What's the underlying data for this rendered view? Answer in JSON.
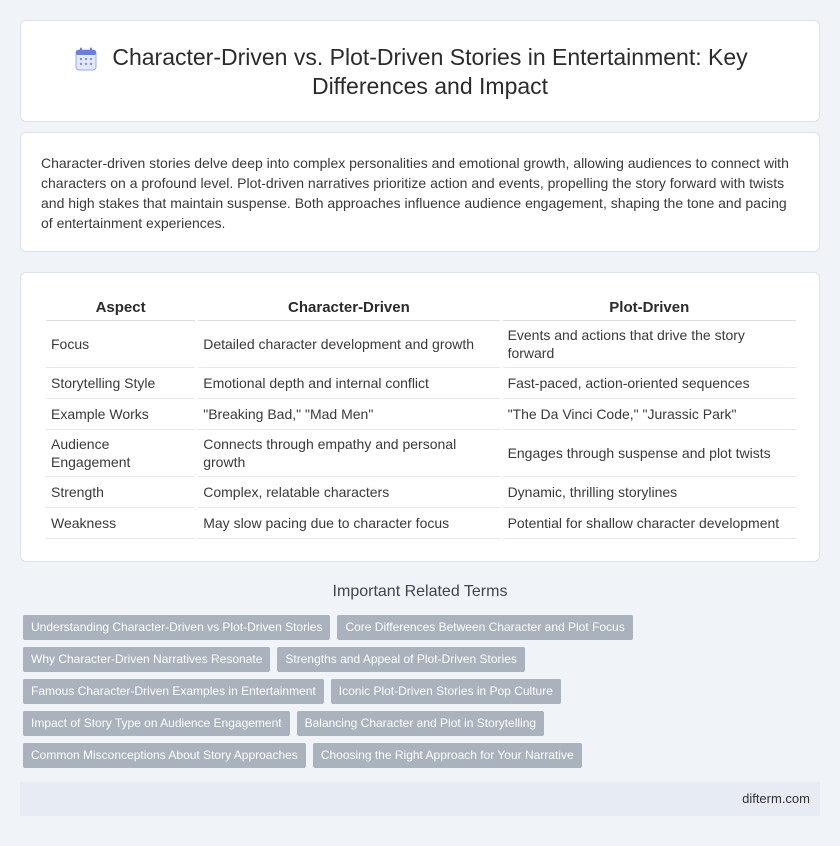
{
  "header": {
    "title": "Character-Driven vs. Plot-Driven Stories in Entertainment: Key Differences and Impact",
    "icon": "document-list-icon"
  },
  "intro": {
    "text": "Character-driven stories delve deep into complex personalities and emotional growth, allowing audiences to connect with characters on a profound level. Plot-driven narratives prioritize action and events, propelling the story forward with twists and high stakes that maintain suspense. Both approaches influence audience engagement, shaping the tone and pacing of entertainment experiences."
  },
  "table": {
    "headers": [
      "Aspect",
      "Character-Driven",
      "Plot-Driven"
    ],
    "rows": [
      [
        "Focus",
        "Detailed character development and growth",
        "Events and actions that drive the story forward"
      ],
      [
        "Storytelling Style",
        "Emotional depth and internal conflict",
        "Fast-paced, action-oriented sequences"
      ],
      [
        "Example Works",
        "\"Breaking Bad,\" \"Mad Men\"",
        "\"The Da Vinci Code,\" \"Jurassic Park\""
      ],
      [
        "Audience Engagement",
        "Connects through empathy and personal growth",
        "Engages through suspense and plot twists"
      ],
      [
        "Strength",
        "Complex, relatable characters",
        "Dynamic, thrilling storylines"
      ],
      [
        "Weakness",
        "May slow pacing due to character focus",
        "Potential for shallow character development"
      ]
    ]
  },
  "related": {
    "title": "Important Related Terms",
    "tags": [
      "Understanding Character-Driven vs Plot-Driven Stories",
      "Core Differences Between Character and Plot Focus",
      "Why Character-Driven Narratives Resonate",
      "Strengths and Appeal of Plot-Driven Stories",
      "Famous Character-Driven Examples in Entertainment",
      "Iconic Plot-Driven Stories in Pop Culture",
      "Impact of Story Type on Audience Engagement",
      "Balancing Character and Plot in Storytelling",
      "Common Misconceptions About Story Approaches",
      "Choosing the Right Approach for Your Narrative"
    ]
  },
  "footer": {
    "brand": "difterm.com"
  },
  "colors": {
    "background": "#f0f3f8",
    "tag": "#aab2bd",
    "icon_accent": "#6c7fd8"
  }
}
